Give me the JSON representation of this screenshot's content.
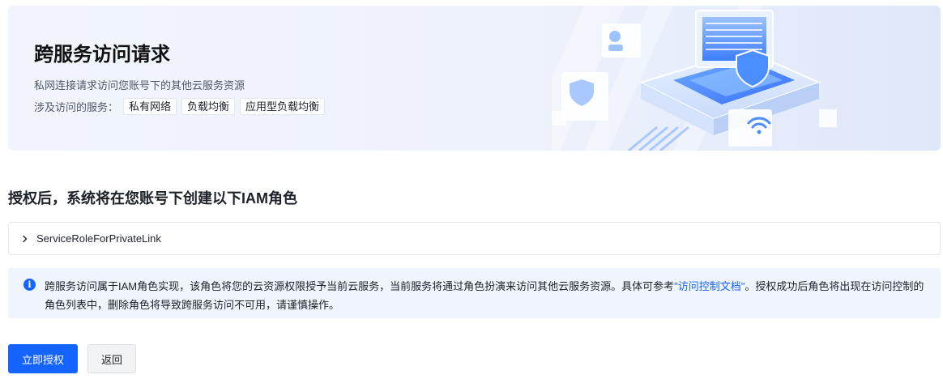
{
  "banner": {
    "title": "跨服务访问请求",
    "description": "私网连接请求访问您账号下的其他云服务资源",
    "services_label": "涉及访问的服务：",
    "services": [
      "私有网络",
      "负载均衡",
      "应用型负载均衡"
    ]
  },
  "section": {
    "title": "授权后，系统将在您账号下创建以下IAM角色"
  },
  "role": {
    "name": "ServiceRoleForPrivateLink",
    "icon": "chevron-right-icon"
  },
  "alert": {
    "icon": "info-icon",
    "text_before": "跨服务访问属于IAM角色实现，该角色将您的云资源权限授予当前云服务，当前服务将通过角色扮演来访问其他云服务资源。具体可参考",
    "link_text": "\"访问控制文档\"",
    "text_after": "。授权成功后角色将出现在访问控制的角色列表中，删除角色将导致跨服务访问不可用，请谨慎操作。"
  },
  "actions": {
    "authorize_label": "立即授权",
    "back_label": "返回"
  },
  "colors": {
    "primary": "#1664ff",
    "alert_bg": "#f0f4fd"
  }
}
